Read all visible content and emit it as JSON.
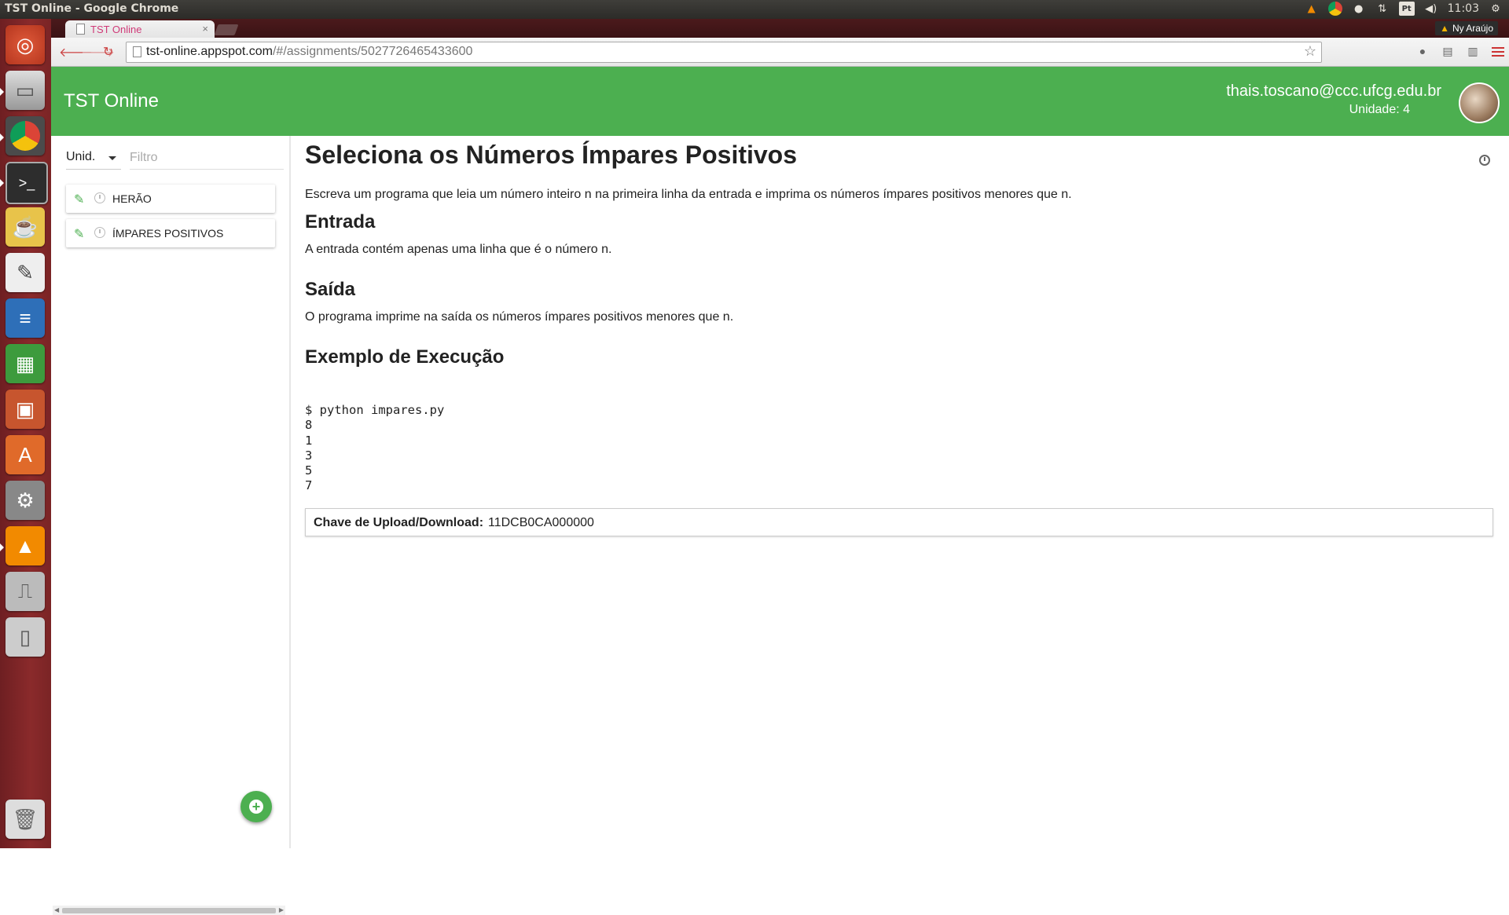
{
  "os": {
    "window_title": "TST Online - Google Chrome",
    "tray": {
      "pt": "Pt",
      "clock": "11:03"
    }
  },
  "browser": {
    "tab_title": "TST Online",
    "user_badge": "Ny Araújo",
    "url_host": "tst-online.appspot.com",
    "url_path": "/#/assignments/5027726465433600"
  },
  "app": {
    "title": "TST Online",
    "user_email": "thais.toscano@ccc.ufcg.edu.br",
    "user_unit": "Unidade: 4",
    "accent_color": "#4caf50"
  },
  "sidebar": {
    "unit_select_label": "Unid.",
    "filter_placeholder": "Filtro",
    "items": [
      {
        "label": "HERÃO"
      },
      {
        "label": "ÍMPARES POSITIVOS"
      }
    ],
    "fab_icon": "+"
  },
  "main": {
    "title": "Seleciona os Números Ímpares Positivos",
    "intro": "Escreva um programa que leia um número inteiro n na primeira linha da entrada e imprima os números ímpares positivos menores que n.",
    "entrada_heading": "Entrada",
    "entrada_text": "A entrada contém apenas uma linha que é o número n.",
    "saida_heading": "Saída",
    "saida_text": "O programa imprime na saída os números ímpares positivos menores que n.",
    "exemplo_heading": "Exemplo de Execução",
    "exemplo_code": "$ python impares.py\n8\n1\n3\n5\n7",
    "upload_key_label": "Chave de Upload/Download:",
    "upload_key_value": "11DCB0CA000000"
  }
}
